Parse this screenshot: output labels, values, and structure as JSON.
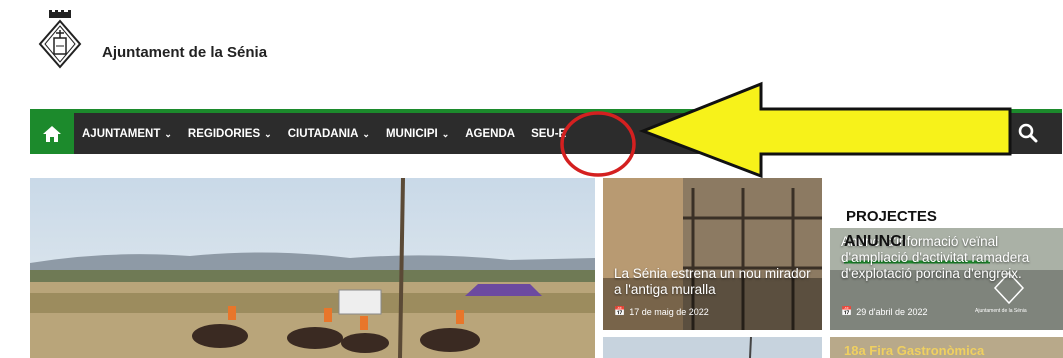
{
  "site": {
    "title": "Ajuntament de la Sénia",
    "logo_icon": "municipal-shield-icon"
  },
  "nav": {
    "home_icon": "home-icon",
    "items": [
      {
        "label": "AJUNTAMENT",
        "has_dropdown": true
      },
      {
        "label": "REGIDORIES",
        "has_dropdown": true
      },
      {
        "label": "CIUTADANIA",
        "has_dropdown": true
      },
      {
        "label": "MUNICIPI",
        "has_dropdown": true
      },
      {
        "label": "AGENDA",
        "has_dropdown": false
      },
      {
        "label": "SEU-E",
        "has_dropdown": false
      }
    ],
    "search_icon": "search-icon"
  },
  "annotations": {
    "highlighted_item": "SEU-E",
    "circle_color": "#d42020",
    "arrow_color": "#f7f21a"
  },
  "cards": [
    {
      "title": "La Sénia estrena un nou mirador a l'antiga muralla",
      "date": "17 de maig de 2022"
    },
    {
      "category": "PROJECTES",
      "label": "ANUNCI",
      "title": "Anunci d'informació veïnal d'ampliació d'activitat ramadera d'explotació porcina d'engreix.",
      "date": "29 d'abril de 2022",
      "watermark": "Ajuntament de la Sénia"
    },
    {
      "title": "18a Fira Gastronòmica"
    }
  ],
  "colors": {
    "brand_green": "#1c8a2c",
    "nav_bg": "#2c2c2c"
  }
}
